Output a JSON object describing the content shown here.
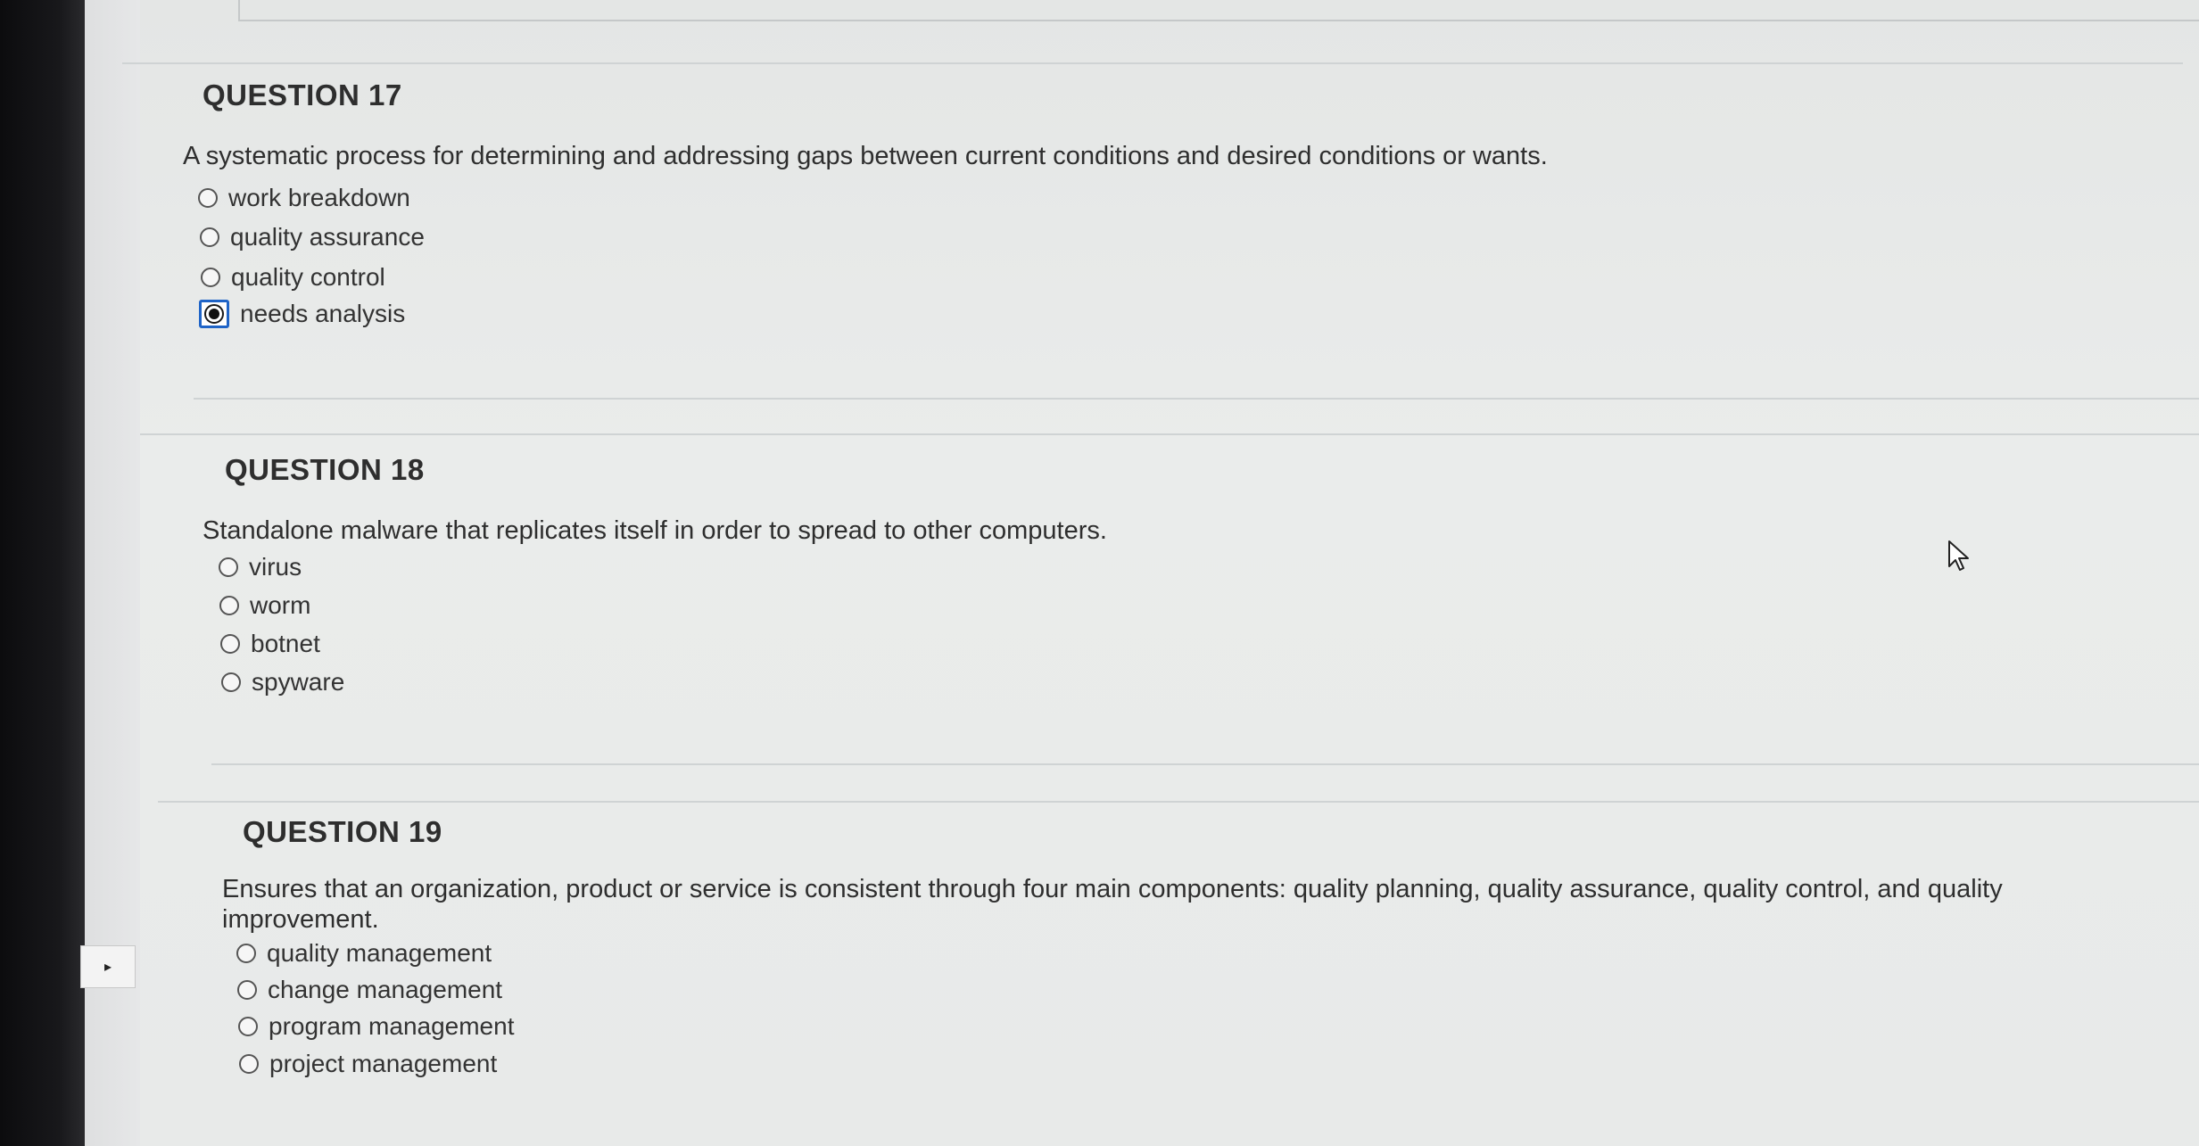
{
  "questions": [
    {
      "title": "QUESTION 17",
      "text": "A systematic process for determining and addressing gaps between current conditions and desired conditions or wants.",
      "answers": [
        {
          "label": "work breakdown",
          "selected": false
        },
        {
          "label": "quality assurance",
          "selected": false
        },
        {
          "label": "quality control",
          "selected": false
        },
        {
          "label": "needs analysis",
          "selected": true
        }
      ]
    },
    {
      "title": "QUESTION 18",
      "text": "Standalone malware that replicates itself in order to spread to other computers.",
      "answers": [
        {
          "label": "virus",
          "selected": false
        },
        {
          "label": "worm",
          "selected": false
        },
        {
          "label": "botnet",
          "selected": false
        },
        {
          "label": "spyware",
          "selected": false
        }
      ]
    },
    {
      "title": "QUESTION 19",
      "text": "Ensures that an organization, product or service is consistent through four main components: quality planning, quality assurance, quality control, and quality improvement.",
      "answers": [
        {
          "label": "quality management",
          "selected": false
        },
        {
          "label": "change management",
          "selected": false
        },
        {
          "label": "program management",
          "selected": false
        },
        {
          "label": "project management",
          "selected": false
        }
      ]
    }
  ],
  "ui": {
    "collapse_toggle_icon": "triangle-right-icon",
    "accent_color": "#1f64c7"
  }
}
